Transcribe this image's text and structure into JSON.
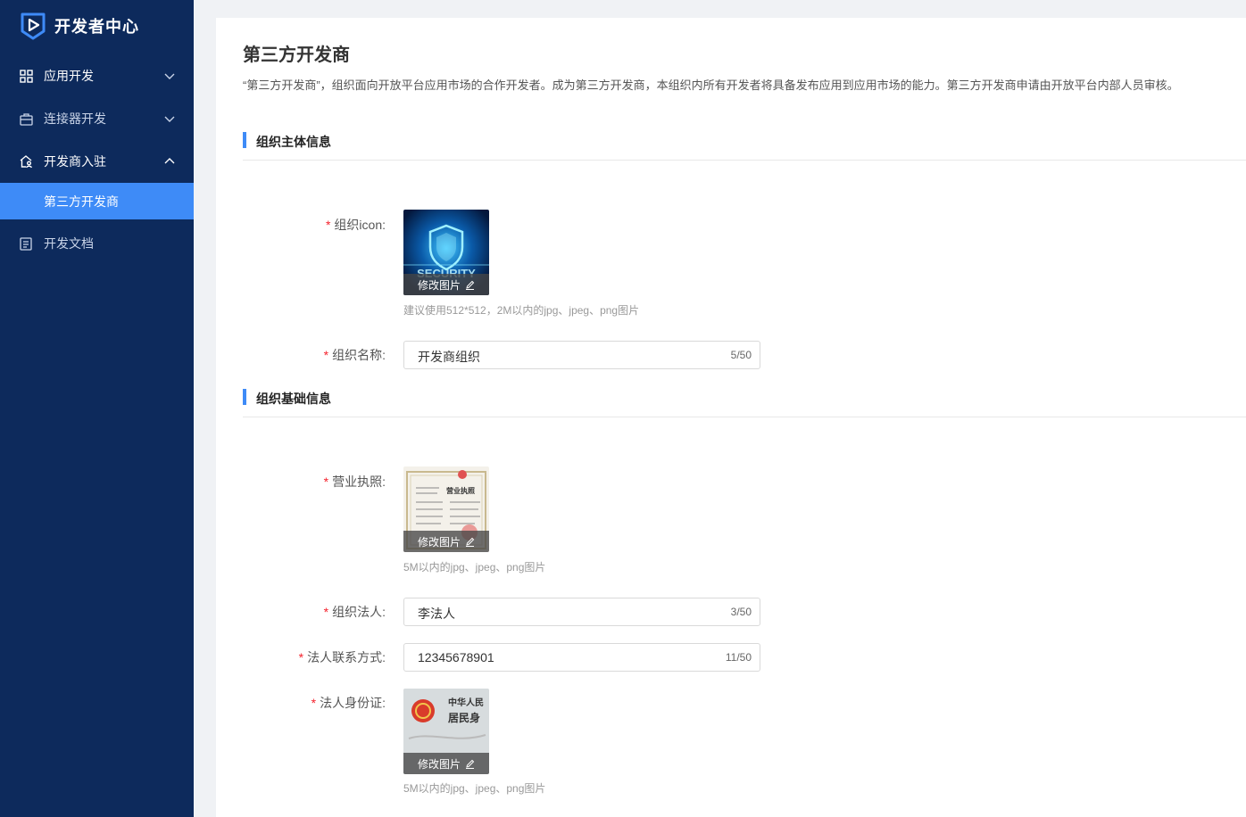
{
  "brand": {
    "title": "开发者中心"
  },
  "sidebar": {
    "items": [
      {
        "label": "应用开发",
        "icon": "grid-icon"
      },
      {
        "label": "连接器开发",
        "icon": "briefcase-icon"
      },
      {
        "label": "开发商入驻",
        "icon": "home-user-icon"
      },
      {
        "label": "第三方开发商"
      },
      {
        "label": "开发文档",
        "icon": "document-icon"
      }
    ]
  },
  "page": {
    "title": "第三方开发商",
    "description": "“第三方开发商”，组织面向开放平台应用市场的合作开发者。成为第三方开发商，本组织内所有开发者将具备发布应用到应用市场的能力。第三方开发商申请由开放平台内部人员审核。"
  },
  "sections": {
    "org_main": "组织主体信息",
    "org_base": "组织基础信息"
  },
  "form": {
    "org_icon": {
      "label": "组织icon:",
      "edit_label": "修改图片",
      "hint": "建议使用512*512，2M以内的jpg、jpeg、png图片",
      "image_text": "SECURITY"
    },
    "org_name": {
      "label": "组织名称:",
      "value": "开发商组织",
      "count": "5/50"
    },
    "license": {
      "label": "营业执照:",
      "edit_label": "修改图片",
      "hint": "5M以内的jpg、jpeg、png图片",
      "image_text": "营业执照"
    },
    "legal_person": {
      "label": "组织法人:",
      "value": "李法人",
      "count": "3/50"
    },
    "contact": {
      "label": "法人联系方式:",
      "value": "12345678901",
      "count": "11/50"
    },
    "id_card": {
      "label": "法人身份证:",
      "edit_label": "修改图片",
      "hint": "5M以内的jpg、jpeg、png图片",
      "image_text_1": "中华人民",
      "image_text_2": "居民身"
    }
  },
  "colors": {
    "sidebar_bg": "#0d2a5c",
    "accent": "#3e8bf7",
    "required": "#f5222d"
  }
}
